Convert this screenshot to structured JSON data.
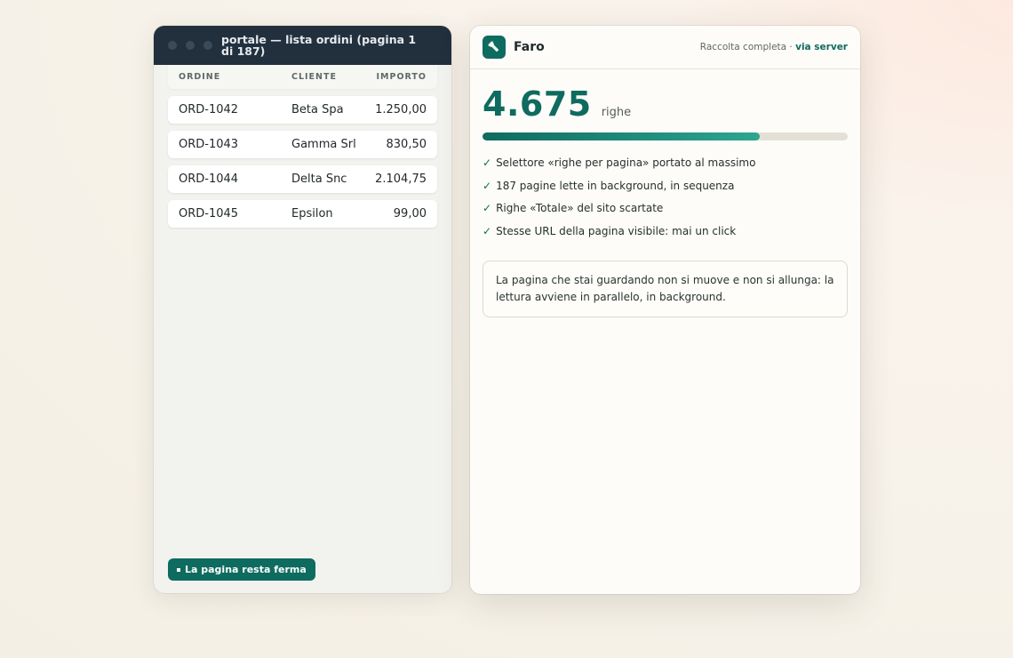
{
  "window": {
    "title": "portale — lista ordini (pagina 1 di 187)"
  },
  "table": {
    "headers": [
      "ORDINE",
      "CLIENTE",
      "IMPORTO"
    ],
    "rows": [
      [
        "ORD-1042",
        "Beta Spa",
        "1.250,00"
      ],
      [
        "ORD-1043",
        "Gamma Srl",
        "830,50"
      ],
      [
        "ORD-1044",
        "Delta Snc",
        "2.104,75"
      ],
      [
        "ORD-1045",
        "Epsilon",
        "99,00"
      ]
    ]
  },
  "badge": {
    "label": "La pagina resta ferma"
  },
  "panel": {
    "brand": "Faro",
    "mode": "Raccolta completa",
    "separator": "·",
    "source": "via server",
    "count": "4.675",
    "unit": "righe",
    "progress": 0.76,
    "checklist": [
      "Selettore «righe per pagina» portato al massimo",
      "187 pagine lette in background, in sequenza",
      "Righe «Totale» del sito scartate",
      "Stesse URL della pagina visibile: mai un click"
    ],
    "note": "La pagina che stai guardando non si muove e non si allunga: la lettura avviene in parallelo, in background."
  },
  "colors": {
    "accent": "#0e6b5f",
    "titlebar": "#22303d"
  },
  "icons": {
    "logo": "flashlight-icon",
    "check": "check-icon"
  }
}
